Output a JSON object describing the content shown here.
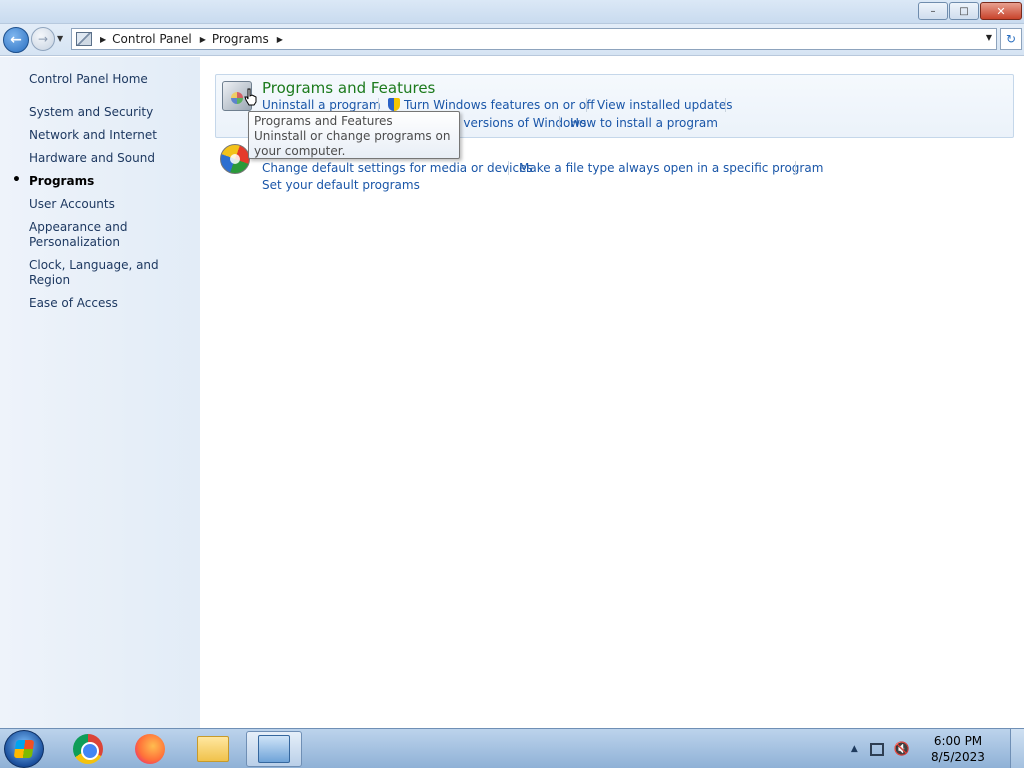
{
  "window": {
    "minimize_label": "–",
    "maximize_label": "□",
    "close_label": "✕"
  },
  "address_bar": {
    "crumbs": [
      "Control Panel",
      "Programs"
    ]
  },
  "left_pane": {
    "home": "Control Panel Home",
    "items": [
      {
        "label": "System and Security"
      },
      {
        "label": "Network and Internet"
      },
      {
        "label": "Hardware and Sound"
      },
      {
        "label": "Programs",
        "active": true
      },
      {
        "label": "User Accounts"
      },
      {
        "label": "Appearance and Personalization"
      },
      {
        "label": "Clock, Language, and Region"
      },
      {
        "label": "Ease of Access"
      }
    ]
  },
  "main": {
    "programs_features": {
      "title": "Programs and Features",
      "links": {
        "uninstall": "Uninstall a program",
        "windows_features": "Turn Windows features on or off",
        "installed_updates": "View installed updates",
        "run_older": "Run programs made for previous versions of Windows",
        "how_install": "How to install a program"
      }
    },
    "default_programs": {
      "links": {
        "change_defaults": "Change default settings for media or devices",
        "file_type": "Make a file type always open in a specific program",
        "set_defaults": "Set your default programs"
      }
    }
  },
  "tooltip": {
    "title": "Programs and Features",
    "body": "Uninstall or change programs on your computer."
  },
  "taskbar": {
    "apps": [
      "start-button",
      "chrome",
      "firefox",
      "file-explorer",
      "control-panel"
    ],
    "time": "6:00 PM",
    "date": "8/5/2023"
  },
  "colors": {
    "link": "#1a56a8",
    "category_title": "#1c7a1c",
    "left_pane_bg": "#e8eff8"
  }
}
